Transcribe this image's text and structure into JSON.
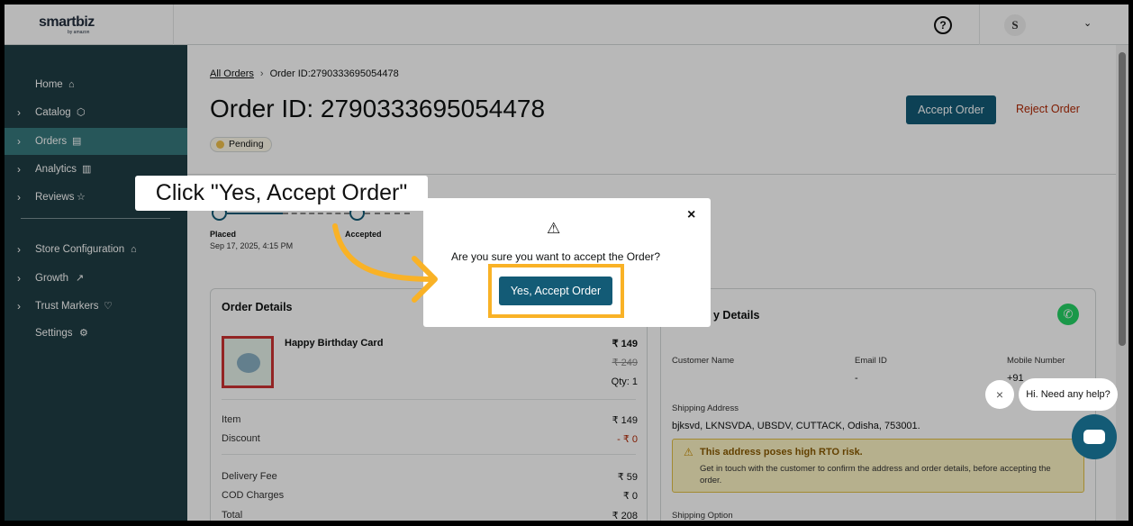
{
  "header": {
    "logo_main": "smartbiz",
    "logo_sub": "by amazon",
    "help_icon": "?",
    "avatar_initial": "S"
  },
  "sidebar": {
    "items": [
      {
        "label": "Home",
        "icon": "home-icon",
        "glyph": "⌂"
      },
      {
        "label": "Catalog",
        "icon": "box-icon",
        "glyph": "⬡"
      },
      {
        "label": "Orders",
        "icon": "clipboard-icon",
        "glyph": "▤"
      },
      {
        "label": "Analytics",
        "icon": "bar-chart-icon",
        "glyph": "▥"
      },
      {
        "label": "Reviews",
        "icon": "star-icon",
        "glyph": "☆"
      },
      {
        "label": "Store Configuration",
        "icon": "store-icon",
        "glyph": "⌂"
      },
      {
        "label": "Growth",
        "icon": "trend-icon",
        "glyph": "↗"
      },
      {
        "label": "Trust Markers",
        "icon": "shield-heart-icon",
        "glyph": "♡"
      },
      {
        "label": "Settings",
        "icon": "gear-icon",
        "glyph": "⚙"
      }
    ]
  },
  "breadcrumb": {
    "root": "All Orders",
    "current": "Order ID:2790333695054478"
  },
  "order": {
    "title": "Order ID: 2790333695054478",
    "status": "Pending",
    "accept_label": "Accept Order",
    "reject_label": "Reject Order"
  },
  "timeline": {
    "placed_label": "Placed",
    "placed_date": "Sep 17, 2025, 4:15 PM",
    "accepted_label": "Accepted"
  },
  "order_details": {
    "title": "Order Details",
    "product_name": "Happy Birthday Card",
    "price": "₹ 149",
    "mrp": "₹ 249",
    "qty": "Qty: 1",
    "rows": [
      {
        "label": "Item",
        "value": "₹ 149"
      },
      {
        "label": "Discount",
        "value": "- ₹ 0"
      },
      {
        "label": "Delivery Fee",
        "value": "₹ 59"
      },
      {
        "label": "COD Charges",
        "value": "₹ 0"
      },
      {
        "label": "Total",
        "value": "₹ 208"
      }
    ]
  },
  "delivery_details": {
    "title": "y Details",
    "customer_name_label": "Customer Name",
    "email_label": "Email ID",
    "email_value": "-",
    "mobile_label": "Mobile Number",
    "mobile_value": "+91",
    "shipping_address_label": "Shipping Address",
    "shipping_address": "bjksvd, LKNSVDA, UBSDV, CUTTACK, Odisha, 753001.",
    "rto_title": "This address poses high RTO risk.",
    "rto_desc": "Get in touch with the customer to confirm the address and order details, before accepting the order.",
    "shipping_option_label": "Shipping Option"
  },
  "modal": {
    "question": "Are you sure you want to accept the Order?",
    "confirm_label": "Yes, Accept Order",
    "close": "×",
    "warning": "⚠"
  },
  "callout": {
    "text": "Click \"Yes, Accept Order\""
  },
  "chat": {
    "greeting": "Hi. Need any help?",
    "close": "×"
  },
  "colors": {
    "sidebar_bg": "#1f3e44",
    "sidebar_active": "#37797d",
    "primary": "#135b76",
    "reject": "#b12704",
    "highlight": "#f9b226"
  }
}
